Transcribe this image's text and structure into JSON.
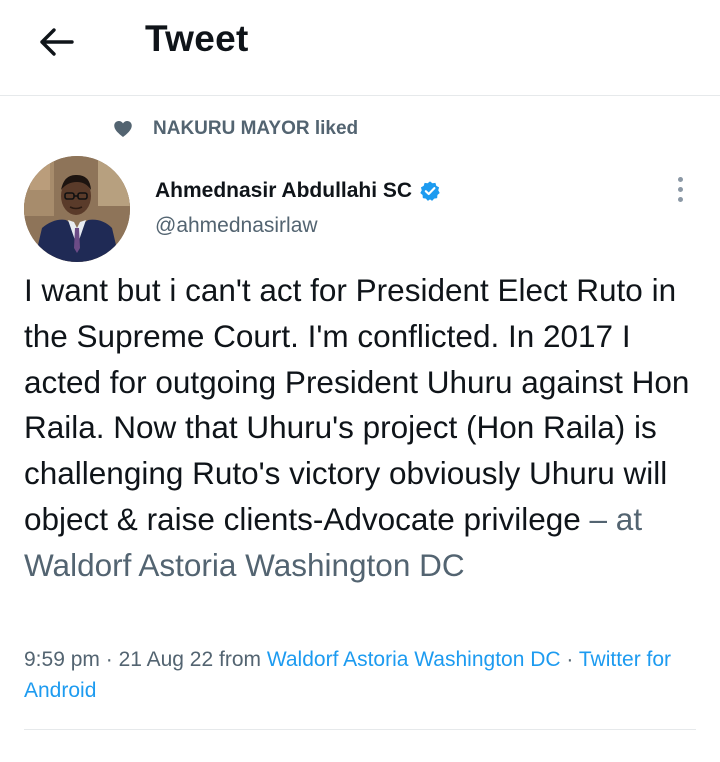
{
  "header": {
    "title": "Tweet",
    "back_icon": "arrow-left-icon"
  },
  "social_context": {
    "icon": "heart-icon",
    "text": "NAKURU MAYOR liked"
  },
  "author": {
    "name": "Ahmednasir Abdullahi SC",
    "handle": "@ahmednasirlaw",
    "verified": true,
    "verified_color": "#1d9bf0"
  },
  "tweet": {
    "text": "I want but i can't act for President Elect Ruto in the Supreme Court. I'm conflicted. In 2017 I acted for outgoing President Uhuru against Hon Raila. Now that Uhuru's project (Hon Raila) is challenging Ruto's victory obviously Uhuru will object & raise clients-Advocate privilege",
    "location_suffix": " – at Waldorf Astoria Washington DC"
  },
  "meta": {
    "time": "9:59 pm",
    "sep1": " · ",
    "date": "21 Aug 22",
    "from_label": " from ",
    "location": "Waldorf Astoria Washington DC",
    "sep2": " · ",
    "source": "Twitter for Android"
  },
  "colors": {
    "link": "#1d9bf0",
    "secondary_text": "#536471",
    "primary_text": "#0f1419"
  }
}
